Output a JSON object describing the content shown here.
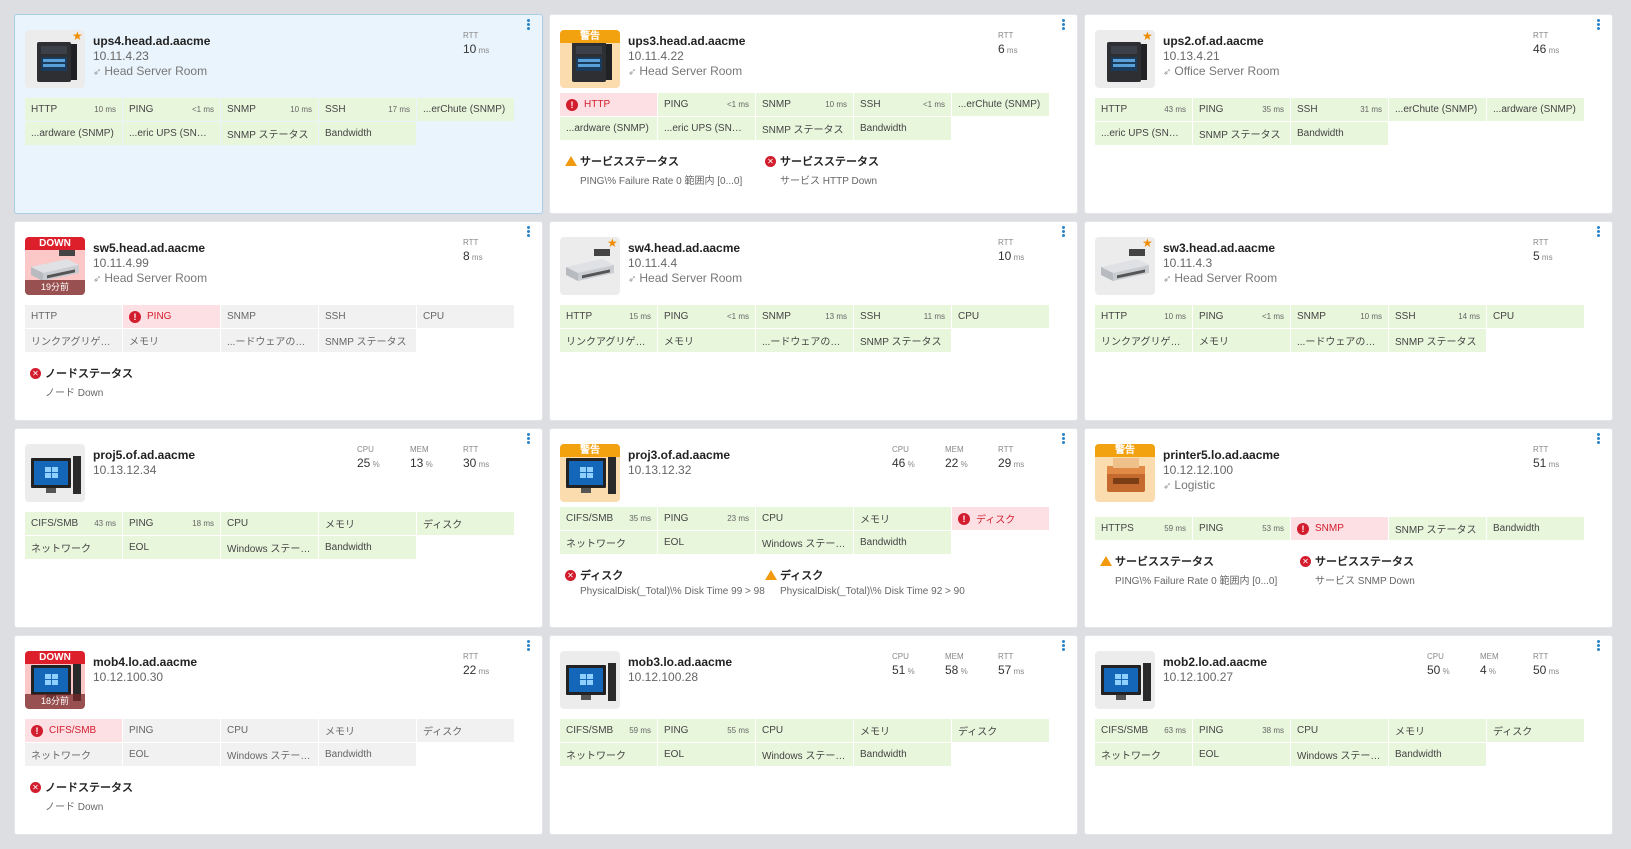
{
  "colors": {
    "ok": "#e8f6dc",
    "error": "#fde0e3",
    "nodata": "#f1f1f1",
    "warn": "#f2a10f",
    "down": "#dd1f2c",
    "accent": "#2a85c8"
  },
  "cards": [
    {
      "name": "ups4.head.ad.aacme",
      "ip": "10.11.4.23",
      "location": "Head Server Room",
      "icon": "ups",
      "fav": true,
      "selected": true,
      "metrics": [
        {
          "label": "RTT",
          "value": "10",
          "unit": "ms"
        }
      ],
      "services": [
        {
          "name": "HTTP",
          "value": "10 ms",
          "state": "ok"
        },
        {
          "name": "PING",
          "value": "<1 ms",
          "state": "ok"
        },
        {
          "name": "SNMP",
          "value": "10 ms",
          "state": "ok"
        },
        {
          "name": "SSH",
          "value": "17 ms",
          "state": "ok"
        },
        {
          "name": "...erChute (SNMP)",
          "value": "",
          "state": "ok"
        },
        {
          "name": "...ardware (SNMP)",
          "value": "",
          "state": "ok"
        },
        {
          "name": "...eric UPS (SNMP)",
          "value": "",
          "state": "ok"
        },
        {
          "name": "SNMP ステータス",
          "value": "",
          "state": "ok"
        },
        {
          "name": "Bandwidth",
          "value": "",
          "state": "ok"
        }
      ],
      "alerts": []
    },
    {
      "name": "ups3.head.ad.aacme",
      "ip": "10.11.4.22",
      "location": "Head Server Room",
      "icon": "ups",
      "badge": "警告",
      "badgeType": "warn",
      "metrics": [
        {
          "label": "RTT",
          "value": "6",
          "unit": "ms"
        }
      ],
      "services": [
        {
          "name": "HTTP",
          "value": "",
          "state": "err"
        },
        {
          "name": "PING",
          "value": "<1 ms",
          "state": "ok"
        },
        {
          "name": "SNMP",
          "value": "10 ms",
          "state": "ok"
        },
        {
          "name": "SSH",
          "value": "<1 ms",
          "state": "ok"
        },
        {
          "name": "...erChute (SNMP)",
          "value": "",
          "state": "ok"
        },
        {
          "name": "...ardware (SNMP)",
          "value": "",
          "state": "ok"
        },
        {
          "name": "...eric UPS (SNMP)",
          "value": "",
          "state": "ok"
        },
        {
          "name": "SNMP ステータス",
          "value": "",
          "state": "ok"
        },
        {
          "name": "Bandwidth",
          "value": "",
          "state": "ok"
        }
      ],
      "alerts": [
        {
          "type": "warn",
          "title": "サービスステータス",
          "detail": "PING\\% Failure Rate 0 範囲内 [0...0]"
        },
        {
          "type": "error",
          "title": "サービスステータス",
          "detail": "サービス HTTP Down"
        }
      ]
    },
    {
      "name": "ups2.of.ad.aacme",
      "ip": "10.13.4.21",
      "location": "Office Server Room",
      "icon": "ups",
      "fav": true,
      "metrics": [
        {
          "label": "RTT",
          "value": "46",
          "unit": "ms"
        }
      ],
      "services": [
        {
          "name": "HTTP",
          "value": "43 ms",
          "state": "ok"
        },
        {
          "name": "PING",
          "value": "35 ms",
          "state": "ok"
        },
        {
          "name": "SSH",
          "value": "31 ms",
          "state": "ok"
        },
        {
          "name": "...erChute (SNMP)",
          "value": "",
          "state": "ok"
        },
        {
          "name": "...ardware (SNMP)",
          "value": "",
          "state": "ok"
        },
        {
          "name": "...eric UPS (SNMP)",
          "value": "",
          "state": "ok"
        },
        {
          "name": "SNMP ステータス",
          "value": "",
          "state": "ok"
        },
        {
          "name": "Bandwidth",
          "value": "",
          "state": "ok"
        }
      ],
      "alerts": []
    },
    {
      "name": "sw5.head.ad.aacme",
      "ip": "10.11.4.99",
      "location": "Head Server Room",
      "icon": "switch",
      "badge": "DOWN",
      "badgeType": "down",
      "ago": "19分前",
      "metrics": [
        {
          "label": "RTT",
          "value": "8",
          "unit": "ms"
        }
      ],
      "services": [
        {
          "name": "HTTP",
          "value": "",
          "state": "nd"
        },
        {
          "name": "PING",
          "value": "",
          "state": "err"
        },
        {
          "name": "SNMP",
          "value": "",
          "state": "nd"
        },
        {
          "name": "SSH",
          "value": "",
          "state": "nd"
        },
        {
          "name": "CPU",
          "value": "",
          "state": "nd"
        },
        {
          "name": "リンクアグリゲーション",
          "value": "",
          "state": "nd"
        },
        {
          "name": "メモリ",
          "value": "",
          "state": "nd"
        },
        {
          "name": "...ードウェアの正常性",
          "value": "",
          "state": "nd"
        },
        {
          "name": "SNMP ステータス",
          "value": "",
          "state": "nd"
        }
      ],
      "alerts": [
        {
          "type": "error",
          "title": "ノードステータス",
          "detail": "ノード Down"
        }
      ]
    },
    {
      "name": "sw4.head.ad.aacme",
      "ip": "10.11.4.4",
      "location": "Head Server Room",
      "icon": "switch",
      "fav": true,
      "metrics": [
        {
          "label": "RTT",
          "value": "10",
          "unit": "ms"
        }
      ],
      "services": [
        {
          "name": "HTTP",
          "value": "15 ms",
          "state": "ok"
        },
        {
          "name": "PING",
          "value": "<1 ms",
          "state": "ok"
        },
        {
          "name": "SNMP",
          "value": "13 ms",
          "state": "ok"
        },
        {
          "name": "SSH",
          "value": "11 ms",
          "state": "ok"
        },
        {
          "name": "CPU",
          "value": "",
          "state": "ok"
        },
        {
          "name": "リンクアグリゲーション",
          "value": "",
          "state": "ok"
        },
        {
          "name": "メモリ",
          "value": "",
          "state": "ok"
        },
        {
          "name": "...ードウェアの正常性",
          "value": "",
          "state": "ok"
        },
        {
          "name": "SNMP ステータス",
          "value": "",
          "state": "ok"
        }
      ],
      "alerts": []
    },
    {
      "name": "sw3.head.ad.aacme",
      "ip": "10.11.4.3",
      "location": "Head Server Room",
      "icon": "switch",
      "fav": true,
      "metrics": [
        {
          "label": "RTT",
          "value": "5",
          "unit": "ms"
        }
      ],
      "services": [
        {
          "name": "HTTP",
          "value": "10 ms",
          "state": "ok"
        },
        {
          "name": "PING",
          "value": "<1 ms",
          "state": "ok"
        },
        {
          "name": "SNMP",
          "value": "10 ms",
          "state": "ok"
        },
        {
          "name": "SSH",
          "value": "14 ms",
          "state": "ok"
        },
        {
          "name": "CPU",
          "value": "",
          "state": "ok"
        },
        {
          "name": "リンクアグリゲーション",
          "value": "",
          "state": "ok"
        },
        {
          "name": "メモリ",
          "value": "",
          "state": "ok"
        },
        {
          "name": "...ードウェアの正常性",
          "value": "",
          "state": "ok"
        },
        {
          "name": "SNMP ステータス",
          "value": "",
          "state": "ok"
        }
      ],
      "alerts": []
    },
    {
      "name": "proj5.of.ad.aacme",
      "ip": "10.13.12.34",
      "location": "",
      "icon": "pc",
      "metrics": [
        {
          "label": "CPU",
          "value": "25",
          "unit": "%"
        },
        {
          "label": "MEM",
          "value": "13",
          "unit": "%"
        },
        {
          "label": "RTT",
          "value": "30",
          "unit": "ms"
        }
      ],
      "services": [
        {
          "name": "CIFS/SMB",
          "value": "43 ms",
          "state": "ok"
        },
        {
          "name": "PING",
          "value": "18 ms",
          "state": "ok"
        },
        {
          "name": "CPU",
          "value": "",
          "state": "ok"
        },
        {
          "name": "メモリ",
          "value": "",
          "state": "ok"
        },
        {
          "name": "ディスク",
          "value": "",
          "state": "ok"
        },
        {
          "name": "ネットワーク",
          "value": "",
          "state": "ok"
        },
        {
          "name": "EOL",
          "value": "",
          "state": "ok"
        },
        {
          "name": "Windows ステータス",
          "value": "",
          "state": "ok"
        },
        {
          "name": "Bandwidth",
          "value": "",
          "state": "ok"
        }
      ],
      "alerts": []
    },
    {
      "name": "proj3.of.ad.aacme",
      "ip": "10.13.12.32",
      "location": "",
      "icon": "pc",
      "badge": "警告",
      "badgeType": "warn",
      "metrics": [
        {
          "label": "CPU",
          "value": "46",
          "unit": "%"
        },
        {
          "label": "MEM",
          "value": "22",
          "unit": "%"
        },
        {
          "label": "RTT",
          "value": "29",
          "unit": "ms"
        }
      ],
      "services": [
        {
          "name": "CIFS/SMB",
          "value": "35 ms",
          "state": "ok"
        },
        {
          "name": "PING",
          "value": "23 ms",
          "state": "ok"
        },
        {
          "name": "CPU",
          "value": "",
          "state": "ok"
        },
        {
          "name": "メモリ",
          "value": "",
          "state": "ok"
        },
        {
          "name": "ディスク",
          "value": "",
          "state": "err"
        },
        {
          "name": "ネットワーク",
          "value": "",
          "state": "ok"
        },
        {
          "name": "EOL",
          "value": "",
          "state": "ok"
        },
        {
          "name": "Windows ステータス",
          "value": "",
          "state": "ok"
        },
        {
          "name": "Bandwidth",
          "value": "",
          "state": "ok"
        }
      ],
      "alerts": [
        {
          "type": "error",
          "title": "ディスク",
          "detail": "PhysicalDisk(_Total)\\% Disk Time 99 > 98"
        },
        {
          "type": "warn",
          "title": "ディスク",
          "detail": "PhysicalDisk(_Total)\\% Disk Time 92 > 90"
        }
      ]
    },
    {
      "name": "printer5.lo.ad.aacme",
      "ip": "10.12.12.100",
      "location": "Logistic",
      "icon": "printer",
      "badge": "警告",
      "badgeType": "warn",
      "metrics": [
        {
          "label": "RTT",
          "value": "51",
          "unit": "ms"
        }
      ],
      "services": [
        {
          "name": "HTTPS",
          "value": "59 ms",
          "state": "ok"
        },
        {
          "name": "PING",
          "value": "53 ms",
          "state": "ok"
        },
        {
          "name": "SNMP",
          "value": "",
          "state": "err"
        },
        {
          "name": "SNMP ステータス",
          "value": "",
          "state": "ok"
        },
        {
          "name": "Bandwidth",
          "value": "",
          "state": "ok"
        }
      ],
      "alerts": [
        {
          "type": "warn",
          "title": "サービスステータス",
          "detail": "PING\\% Failure Rate 0 範囲内 [0...0]"
        },
        {
          "type": "error",
          "title": "サービスステータス",
          "detail": "サービス SNMP Down"
        }
      ]
    },
    {
      "name": "mob4.lo.ad.aacme",
      "ip": "10.12.100.30",
      "location": "",
      "icon": "pc",
      "badge": "DOWN",
      "badgeType": "down",
      "ago": "18分前",
      "metrics": [
        {
          "label": "RTT",
          "value": "22",
          "unit": "ms"
        }
      ],
      "services": [
        {
          "name": "CIFS/SMB",
          "value": "",
          "state": "err"
        },
        {
          "name": "PING",
          "value": "",
          "state": "nd"
        },
        {
          "name": "CPU",
          "value": "",
          "state": "nd"
        },
        {
          "name": "メモリ",
          "value": "",
          "state": "nd"
        },
        {
          "name": "ディスク",
          "value": "",
          "state": "nd"
        },
        {
          "name": "ネットワーク",
          "value": "",
          "state": "nd"
        },
        {
          "name": "EOL",
          "value": "",
          "state": "nd"
        },
        {
          "name": "Windows ステータス",
          "value": "",
          "state": "nd"
        },
        {
          "name": "Bandwidth",
          "value": "",
          "state": "nd"
        }
      ],
      "alerts": [
        {
          "type": "error",
          "title": "ノードステータス",
          "detail": "ノード Down"
        }
      ]
    },
    {
      "name": "mob3.lo.ad.aacme",
      "ip": "10.12.100.28",
      "location": "",
      "icon": "pc",
      "metrics": [
        {
          "label": "CPU",
          "value": "51",
          "unit": "%"
        },
        {
          "label": "MEM",
          "value": "58",
          "unit": "%"
        },
        {
          "label": "RTT",
          "value": "57",
          "unit": "ms"
        }
      ],
      "services": [
        {
          "name": "CIFS/SMB",
          "value": "59 ms",
          "state": "ok"
        },
        {
          "name": "PING",
          "value": "55 ms",
          "state": "ok"
        },
        {
          "name": "CPU",
          "value": "",
          "state": "ok"
        },
        {
          "name": "メモリ",
          "value": "",
          "state": "ok"
        },
        {
          "name": "ディスク",
          "value": "",
          "state": "ok"
        },
        {
          "name": "ネットワーク",
          "value": "",
          "state": "ok"
        },
        {
          "name": "EOL",
          "value": "",
          "state": "ok"
        },
        {
          "name": "Windows ステータス",
          "value": "",
          "state": "ok"
        },
        {
          "name": "Bandwidth",
          "value": "",
          "state": "ok"
        }
      ],
      "alerts": []
    },
    {
      "name": "mob2.lo.ad.aacme",
      "ip": "10.12.100.27",
      "location": "",
      "icon": "pc",
      "metrics": [
        {
          "label": "CPU",
          "value": "50",
          "unit": "%"
        },
        {
          "label": "MEM",
          "value": "4",
          "unit": "%"
        },
        {
          "label": "RTT",
          "value": "50",
          "unit": "ms"
        }
      ],
      "services": [
        {
          "name": "CIFS/SMB",
          "value": "63 ms",
          "state": "ok"
        },
        {
          "name": "PING",
          "value": "38 ms",
          "state": "ok"
        },
        {
          "name": "CPU",
          "value": "",
          "state": "ok"
        },
        {
          "name": "メモリ",
          "value": "",
          "state": "ok"
        },
        {
          "name": "ディスク",
          "value": "",
          "state": "ok"
        },
        {
          "name": "ネットワーク",
          "value": "",
          "state": "ok"
        },
        {
          "name": "EOL",
          "value": "",
          "state": "ok"
        },
        {
          "name": "Windows ステータス",
          "value": "",
          "state": "ok"
        },
        {
          "name": "Bandwidth",
          "value": "",
          "state": "ok"
        }
      ],
      "alerts": []
    }
  ]
}
